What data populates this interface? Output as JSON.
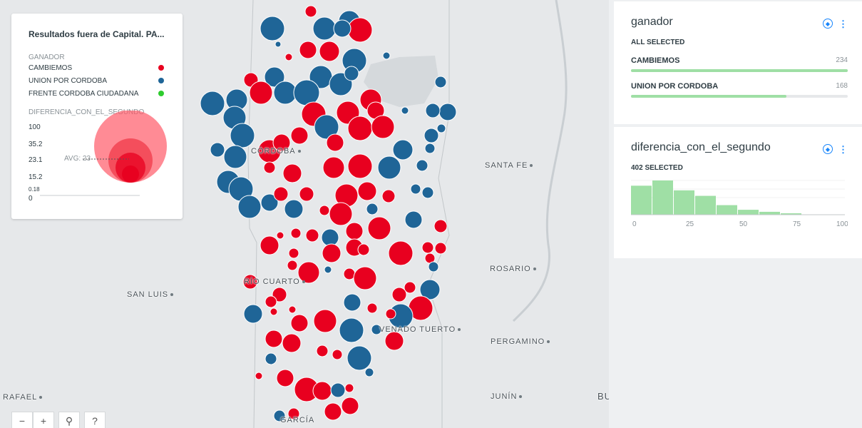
{
  "legend": {
    "title": "Resultados fuera de Capital. PA...",
    "category_label": "GANADOR",
    "categories": [
      {
        "label": "CAMBIEMOS",
        "color": "#e8001f"
      },
      {
        "label": "UNION POR CORDOBA",
        "color": "#1f6597"
      },
      {
        "label": "FRENTE CORDOBA CIUDADANA",
        "color": "#2ecc2e"
      }
    ],
    "size_label": "DIFERENCIA_CON_EL_SEGUNDO",
    "size_values": [
      "100",
      "35.2",
      "23.1",
      "15.2",
      "0.18",
      "0"
    ],
    "avg_label": "AVG: 23"
  },
  "map": {
    "cities": [
      "CÓRDOBA",
      "SANTA FE",
      "ROSARIO",
      "RÍO CUARTO",
      "SAN LUIS",
      "VENADO TUERTO",
      "PERGAMINO",
      "JUNÍN",
      "RAFAEL",
      "BU",
      "GARCÍA"
    ]
  },
  "controls": {
    "zoom_out": "−",
    "zoom_in": "+",
    "search": "⚲",
    "help": "?"
  },
  "widgets": {
    "ganador": {
      "title": "ganador",
      "selection": "ALL SELECTED",
      "items": [
        {
          "label": "CAMBIEMOS",
          "count": "234",
          "fraction": 1.0
        },
        {
          "label": "UNION POR CORDOBA",
          "count": "168",
          "fraction": 0.718
        }
      ]
    },
    "diferencia": {
      "title": "diferencia_con_el_segundo",
      "selection": "402 SELECTED",
      "hist_values": [
        100,
        118,
        84,
        65,
        33,
        17,
        10,
        5,
        0,
        0
      ],
      "ticks": [
        "0",
        "25",
        "50",
        "75",
        "100"
      ]
    }
  },
  "colors": {
    "cambiemos": "#e8001f",
    "union": "#1f6597",
    "frente": "#2ecc2e",
    "bar": "#9fdfa5",
    "accent": "#1785fb"
  }
}
